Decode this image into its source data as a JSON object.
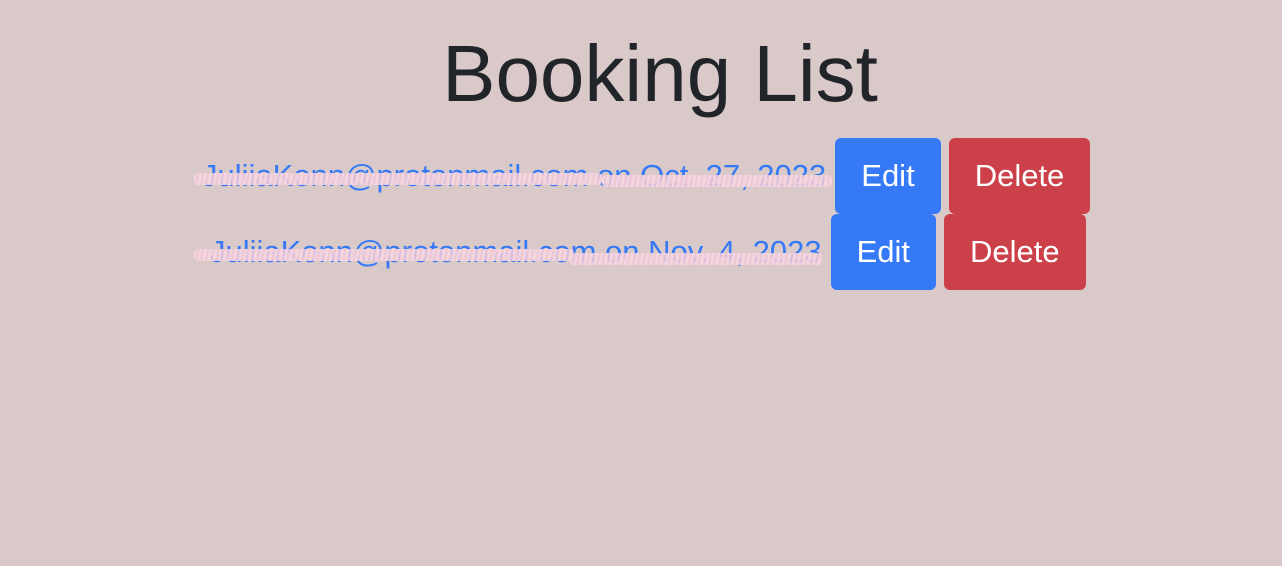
{
  "page": {
    "title": "Booking List"
  },
  "bookings": [
    {
      "label": "JuliiaKonn@protonmail.com on Oct. 27, 2023",
      "edit_label": "Edit",
      "delete_label": "Delete"
    },
    {
      "label": "JuliiaKonn@protonmail.com on Nov. 4, 2023",
      "edit_label": "Edit",
      "delete_label": "Delete"
    }
  ],
  "colors": {
    "background": "#d9c9c9",
    "link": "#3579f6",
    "edit_button": "#3579f6",
    "delete_button": "#cc4049",
    "title": "#212529"
  }
}
